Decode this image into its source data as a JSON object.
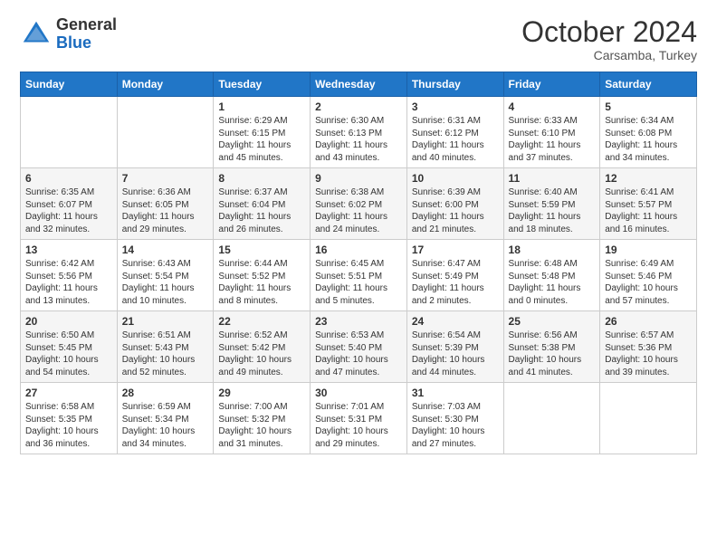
{
  "header": {
    "logo_general": "General",
    "logo_blue": "Blue",
    "month_title": "October 2024",
    "subtitle": "Carsamba, Turkey"
  },
  "days_of_week": [
    "Sunday",
    "Monday",
    "Tuesday",
    "Wednesday",
    "Thursday",
    "Friday",
    "Saturday"
  ],
  "weeks": [
    [
      {
        "day": "",
        "sunrise": "",
        "sunset": "",
        "daylight": ""
      },
      {
        "day": "",
        "sunrise": "",
        "sunset": "",
        "daylight": ""
      },
      {
        "day": "1",
        "sunrise": "Sunrise: 6:29 AM",
        "sunset": "Sunset: 6:15 PM",
        "daylight": "Daylight: 11 hours and 45 minutes."
      },
      {
        "day": "2",
        "sunrise": "Sunrise: 6:30 AM",
        "sunset": "Sunset: 6:13 PM",
        "daylight": "Daylight: 11 hours and 43 minutes."
      },
      {
        "day": "3",
        "sunrise": "Sunrise: 6:31 AM",
        "sunset": "Sunset: 6:12 PM",
        "daylight": "Daylight: 11 hours and 40 minutes."
      },
      {
        "day": "4",
        "sunrise": "Sunrise: 6:33 AM",
        "sunset": "Sunset: 6:10 PM",
        "daylight": "Daylight: 11 hours and 37 minutes."
      },
      {
        "day": "5",
        "sunrise": "Sunrise: 6:34 AM",
        "sunset": "Sunset: 6:08 PM",
        "daylight": "Daylight: 11 hours and 34 minutes."
      }
    ],
    [
      {
        "day": "6",
        "sunrise": "Sunrise: 6:35 AM",
        "sunset": "Sunset: 6:07 PM",
        "daylight": "Daylight: 11 hours and 32 minutes."
      },
      {
        "day": "7",
        "sunrise": "Sunrise: 6:36 AM",
        "sunset": "Sunset: 6:05 PM",
        "daylight": "Daylight: 11 hours and 29 minutes."
      },
      {
        "day": "8",
        "sunrise": "Sunrise: 6:37 AM",
        "sunset": "Sunset: 6:04 PM",
        "daylight": "Daylight: 11 hours and 26 minutes."
      },
      {
        "day": "9",
        "sunrise": "Sunrise: 6:38 AM",
        "sunset": "Sunset: 6:02 PM",
        "daylight": "Daylight: 11 hours and 24 minutes."
      },
      {
        "day": "10",
        "sunrise": "Sunrise: 6:39 AM",
        "sunset": "Sunset: 6:00 PM",
        "daylight": "Daylight: 11 hours and 21 minutes."
      },
      {
        "day": "11",
        "sunrise": "Sunrise: 6:40 AM",
        "sunset": "Sunset: 5:59 PM",
        "daylight": "Daylight: 11 hours and 18 minutes."
      },
      {
        "day": "12",
        "sunrise": "Sunrise: 6:41 AM",
        "sunset": "Sunset: 5:57 PM",
        "daylight": "Daylight: 11 hours and 16 minutes."
      }
    ],
    [
      {
        "day": "13",
        "sunrise": "Sunrise: 6:42 AM",
        "sunset": "Sunset: 5:56 PM",
        "daylight": "Daylight: 11 hours and 13 minutes."
      },
      {
        "day": "14",
        "sunrise": "Sunrise: 6:43 AM",
        "sunset": "Sunset: 5:54 PM",
        "daylight": "Daylight: 11 hours and 10 minutes."
      },
      {
        "day": "15",
        "sunrise": "Sunrise: 6:44 AM",
        "sunset": "Sunset: 5:52 PM",
        "daylight": "Daylight: 11 hours and 8 minutes."
      },
      {
        "day": "16",
        "sunrise": "Sunrise: 6:45 AM",
        "sunset": "Sunset: 5:51 PM",
        "daylight": "Daylight: 11 hours and 5 minutes."
      },
      {
        "day": "17",
        "sunrise": "Sunrise: 6:47 AM",
        "sunset": "Sunset: 5:49 PM",
        "daylight": "Daylight: 11 hours and 2 minutes."
      },
      {
        "day": "18",
        "sunrise": "Sunrise: 6:48 AM",
        "sunset": "Sunset: 5:48 PM",
        "daylight": "Daylight: 11 hours and 0 minutes."
      },
      {
        "day": "19",
        "sunrise": "Sunrise: 6:49 AM",
        "sunset": "Sunset: 5:46 PM",
        "daylight": "Daylight: 10 hours and 57 minutes."
      }
    ],
    [
      {
        "day": "20",
        "sunrise": "Sunrise: 6:50 AM",
        "sunset": "Sunset: 5:45 PM",
        "daylight": "Daylight: 10 hours and 54 minutes."
      },
      {
        "day": "21",
        "sunrise": "Sunrise: 6:51 AM",
        "sunset": "Sunset: 5:43 PM",
        "daylight": "Daylight: 10 hours and 52 minutes."
      },
      {
        "day": "22",
        "sunrise": "Sunrise: 6:52 AM",
        "sunset": "Sunset: 5:42 PM",
        "daylight": "Daylight: 10 hours and 49 minutes."
      },
      {
        "day": "23",
        "sunrise": "Sunrise: 6:53 AM",
        "sunset": "Sunset: 5:40 PM",
        "daylight": "Daylight: 10 hours and 47 minutes."
      },
      {
        "day": "24",
        "sunrise": "Sunrise: 6:54 AM",
        "sunset": "Sunset: 5:39 PM",
        "daylight": "Daylight: 10 hours and 44 minutes."
      },
      {
        "day": "25",
        "sunrise": "Sunrise: 6:56 AM",
        "sunset": "Sunset: 5:38 PM",
        "daylight": "Daylight: 10 hours and 41 minutes."
      },
      {
        "day": "26",
        "sunrise": "Sunrise: 6:57 AM",
        "sunset": "Sunset: 5:36 PM",
        "daylight": "Daylight: 10 hours and 39 minutes."
      }
    ],
    [
      {
        "day": "27",
        "sunrise": "Sunrise: 6:58 AM",
        "sunset": "Sunset: 5:35 PM",
        "daylight": "Daylight: 10 hours and 36 minutes."
      },
      {
        "day": "28",
        "sunrise": "Sunrise: 6:59 AM",
        "sunset": "Sunset: 5:34 PM",
        "daylight": "Daylight: 10 hours and 34 minutes."
      },
      {
        "day": "29",
        "sunrise": "Sunrise: 7:00 AM",
        "sunset": "Sunset: 5:32 PM",
        "daylight": "Daylight: 10 hours and 31 minutes."
      },
      {
        "day": "30",
        "sunrise": "Sunrise: 7:01 AM",
        "sunset": "Sunset: 5:31 PM",
        "daylight": "Daylight: 10 hours and 29 minutes."
      },
      {
        "day": "31",
        "sunrise": "Sunrise: 7:03 AM",
        "sunset": "Sunset: 5:30 PM",
        "daylight": "Daylight: 10 hours and 27 minutes."
      },
      {
        "day": "",
        "sunrise": "",
        "sunset": "",
        "daylight": ""
      },
      {
        "day": "",
        "sunrise": "",
        "sunset": "",
        "daylight": ""
      }
    ]
  ]
}
